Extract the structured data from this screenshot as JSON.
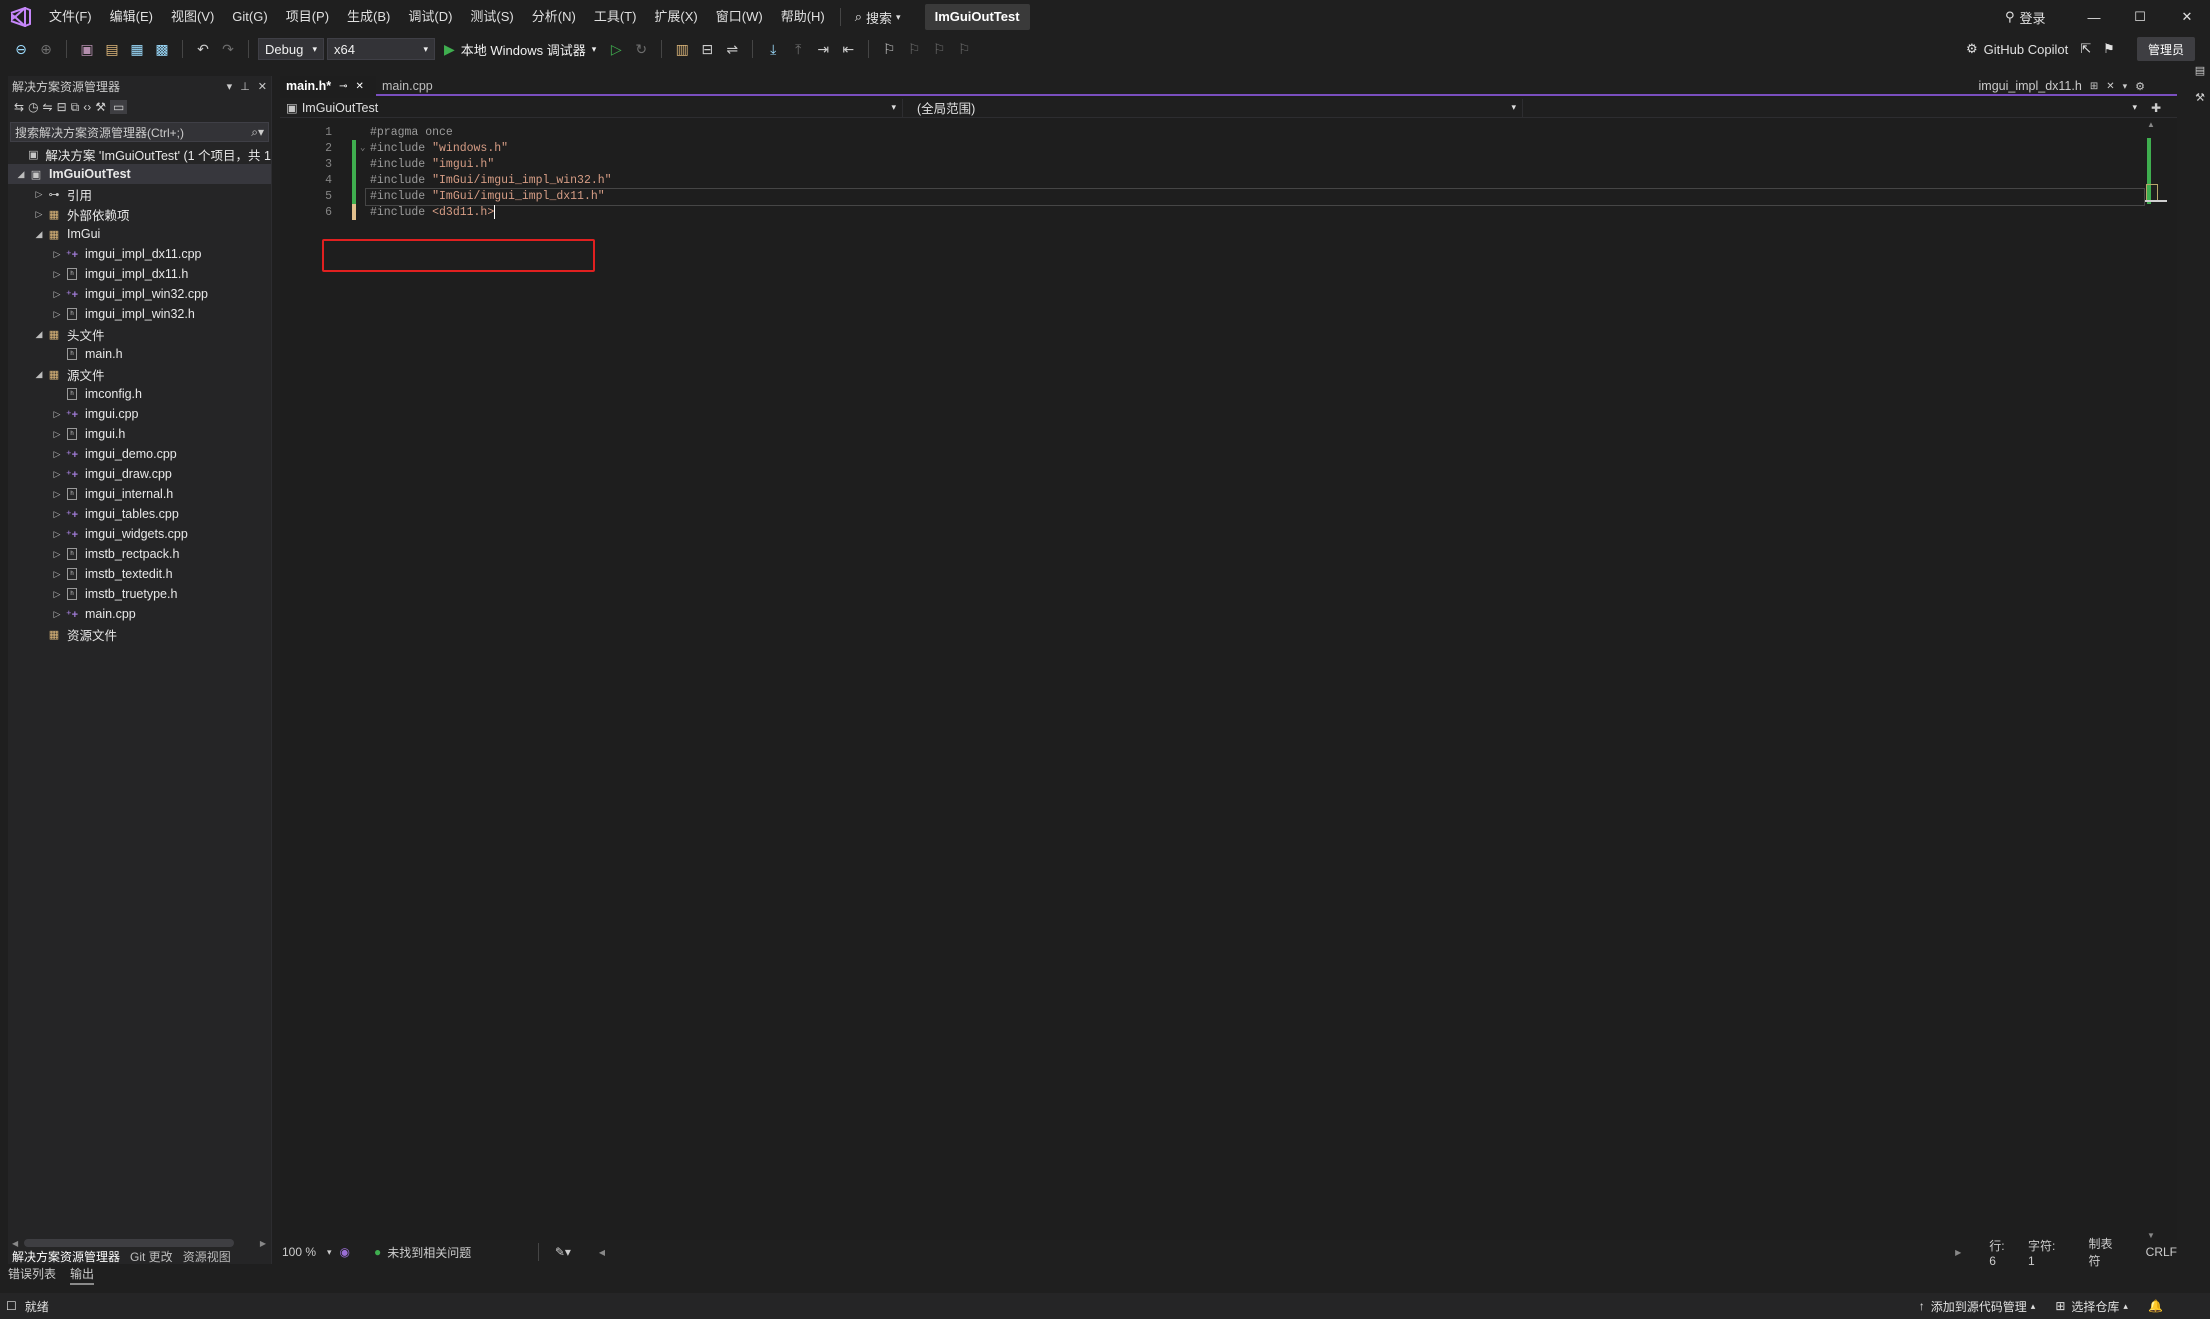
{
  "titlebar": {
    "menu": [
      "文件(F)",
      "编辑(E)",
      "视图(V)",
      "Git(G)",
      "项目(P)",
      "生成(B)",
      "调试(D)",
      "测试(S)",
      "分析(N)",
      "工具(T)",
      "扩展(X)",
      "窗口(W)",
      "帮助(H)"
    ],
    "search_label": "搜索",
    "solution_title": "ImGuiOutTest",
    "login_label": "登录"
  },
  "toolbar": {
    "configuration": "Debug",
    "platform": "x64",
    "run_label": "本地 Windows 调试器",
    "copilot_label": "GitHub Copilot",
    "admin_label": "管理员"
  },
  "solution_explorer": {
    "title": "解决方案资源管理器",
    "search_placeholder": "搜索解决方案资源管理器(Ctrl+;)",
    "tree": [
      {
        "label": "解决方案 'ImGuiOutTest' (1 个项目，共 1",
        "level": 0,
        "arrow": "",
        "icon": "solution"
      },
      {
        "label": "ImGuiOutTest",
        "level": 0,
        "arrow": "▲",
        "icon": "project",
        "bold": true,
        "selected": true
      },
      {
        "label": "引用",
        "level": 1,
        "arrow": "▶",
        "icon": "ref"
      },
      {
        "label": "外部依赖项",
        "level": 1,
        "arrow": "▶",
        "icon": "folder"
      },
      {
        "label": "ImGui",
        "level": 1,
        "arrow": "▲",
        "icon": "folder"
      },
      {
        "label": "imgui_impl_dx11.cpp",
        "level": 2,
        "arrow": "▶",
        "icon": "cpp"
      },
      {
        "label": "imgui_impl_dx11.h",
        "level": 2,
        "arrow": "▶",
        "icon": "h"
      },
      {
        "label": "imgui_impl_win32.cpp",
        "level": 2,
        "arrow": "▶",
        "icon": "cpp"
      },
      {
        "label": "imgui_impl_win32.h",
        "level": 2,
        "arrow": "▶",
        "icon": "h"
      },
      {
        "label": "头文件",
        "level": 1,
        "arrow": "▲",
        "icon": "folder"
      },
      {
        "label": "main.h",
        "level": 2,
        "arrow": "",
        "icon": "h"
      },
      {
        "label": "源文件",
        "level": 1,
        "arrow": "▲",
        "icon": "folder"
      },
      {
        "label": "imconfig.h",
        "level": 2,
        "arrow": "",
        "icon": "h"
      },
      {
        "label": "imgui.cpp",
        "level": 2,
        "arrow": "▶",
        "icon": "cpp"
      },
      {
        "label": "imgui.h",
        "level": 2,
        "arrow": "▶",
        "icon": "h"
      },
      {
        "label": "imgui_demo.cpp",
        "level": 2,
        "arrow": "▶",
        "icon": "cpp"
      },
      {
        "label": "imgui_draw.cpp",
        "level": 2,
        "arrow": "▶",
        "icon": "cpp"
      },
      {
        "label": "imgui_internal.h",
        "level": 2,
        "arrow": "▶",
        "icon": "h"
      },
      {
        "label": "imgui_tables.cpp",
        "level": 2,
        "arrow": "▶",
        "icon": "cpp"
      },
      {
        "label": "imgui_widgets.cpp",
        "level": 2,
        "arrow": "▶",
        "icon": "cpp"
      },
      {
        "label": "imstb_rectpack.h",
        "level": 2,
        "arrow": "▶",
        "icon": "h"
      },
      {
        "label": "imstb_textedit.h",
        "level": 2,
        "arrow": "▶",
        "icon": "h"
      },
      {
        "label": "imstb_truetype.h",
        "level": 2,
        "arrow": "▶",
        "icon": "h"
      },
      {
        "label": "main.cpp",
        "level": 2,
        "arrow": "▶",
        "icon": "cpp"
      },
      {
        "label": "资源文件",
        "level": 1,
        "arrow": "",
        "icon": "folder"
      }
    ],
    "bottom_tabs": [
      "解决方案资源管理器",
      "Git 更改",
      "资源视图"
    ]
  },
  "editor": {
    "tabs": [
      {
        "label": "main.h*",
        "active": true
      },
      {
        "label": "main.cpp",
        "active": false
      }
    ],
    "preview_tab": "imgui_impl_dx11.h",
    "nav_project": "ImGuiOutTest",
    "nav_scope": "(全局范围)",
    "lines": [
      {
        "n": "1",
        "pre": "#pragma once",
        "str": "",
        "bar": ""
      },
      {
        "n": "2",
        "pre": "#include ",
        "str": "\"windows.h\"",
        "bar": "green",
        "fold": "⌄"
      },
      {
        "n": "3",
        "pre": "#include ",
        "str": "\"imgui.h\"",
        "bar": "green"
      },
      {
        "n": "4",
        "pre": "#include ",
        "str": "\"ImGui/imgui_impl_win32.h\"",
        "bar": "green"
      },
      {
        "n": "5",
        "pre": "#include ",
        "str": "\"ImGui/imgui_impl_dx11.h\"",
        "bar": "green"
      },
      {
        "n": "6",
        "pre": "#include ",
        "str": "<d3d11.h>",
        "bar": "yellow"
      }
    ],
    "footer": {
      "zoom": "100 %",
      "issues": "未找到相关问题",
      "line": "行: 6",
      "char": "字符: 1",
      "indent": "制表符",
      "eol": "CRLF"
    }
  },
  "bottom_panel_tabs": [
    "错误列表",
    "输出"
  ],
  "statusbar": {
    "ready": "就绪",
    "add_source": "添加到源代码管理",
    "select_repo": "选择仓库"
  },
  "colors": {
    "accent": "#7a4fbf",
    "highlight_box": "#e02020",
    "change_green": "#3fae4f",
    "change_yellow": "#e2c08d"
  }
}
